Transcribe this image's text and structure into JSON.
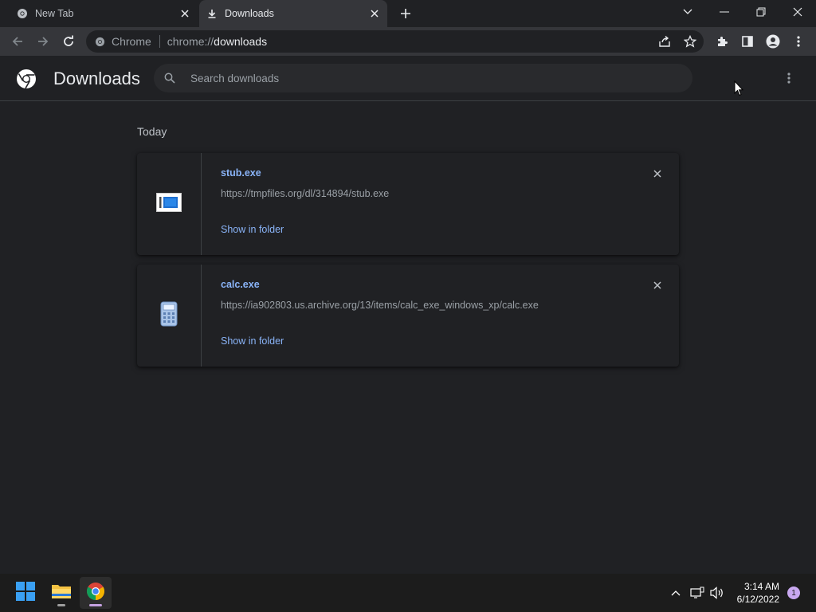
{
  "tabs": [
    {
      "title": "New Tab"
    },
    {
      "title": "Downloads"
    }
  ],
  "omnibox": {
    "chip": "Chrome",
    "url_prefix": "chrome://",
    "url_host": "downloads"
  },
  "header": {
    "title": "Downloads",
    "search_placeholder": "Search downloads"
  },
  "section_label": "Today",
  "downloads": [
    {
      "name": "stub.exe",
      "url": "https://tmpfiles.org/dl/314894/stub.exe",
      "action": "Show in folder",
      "icon": "exe-window-icon"
    },
    {
      "name": "calc.exe",
      "url": "https://ia902803.us.archive.org/13/items/calc_exe_windows_xp/calc.exe",
      "action": "Show in folder",
      "icon": "calculator-icon"
    }
  ],
  "taskbar": {
    "time": "3:14 AM",
    "date": "6/12/2022",
    "notification_count": "1"
  },
  "colors": {
    "accent_link": "#8ab4f8",
    "background": "#202124",
    "toolbar": "#35363a"
  }
}
